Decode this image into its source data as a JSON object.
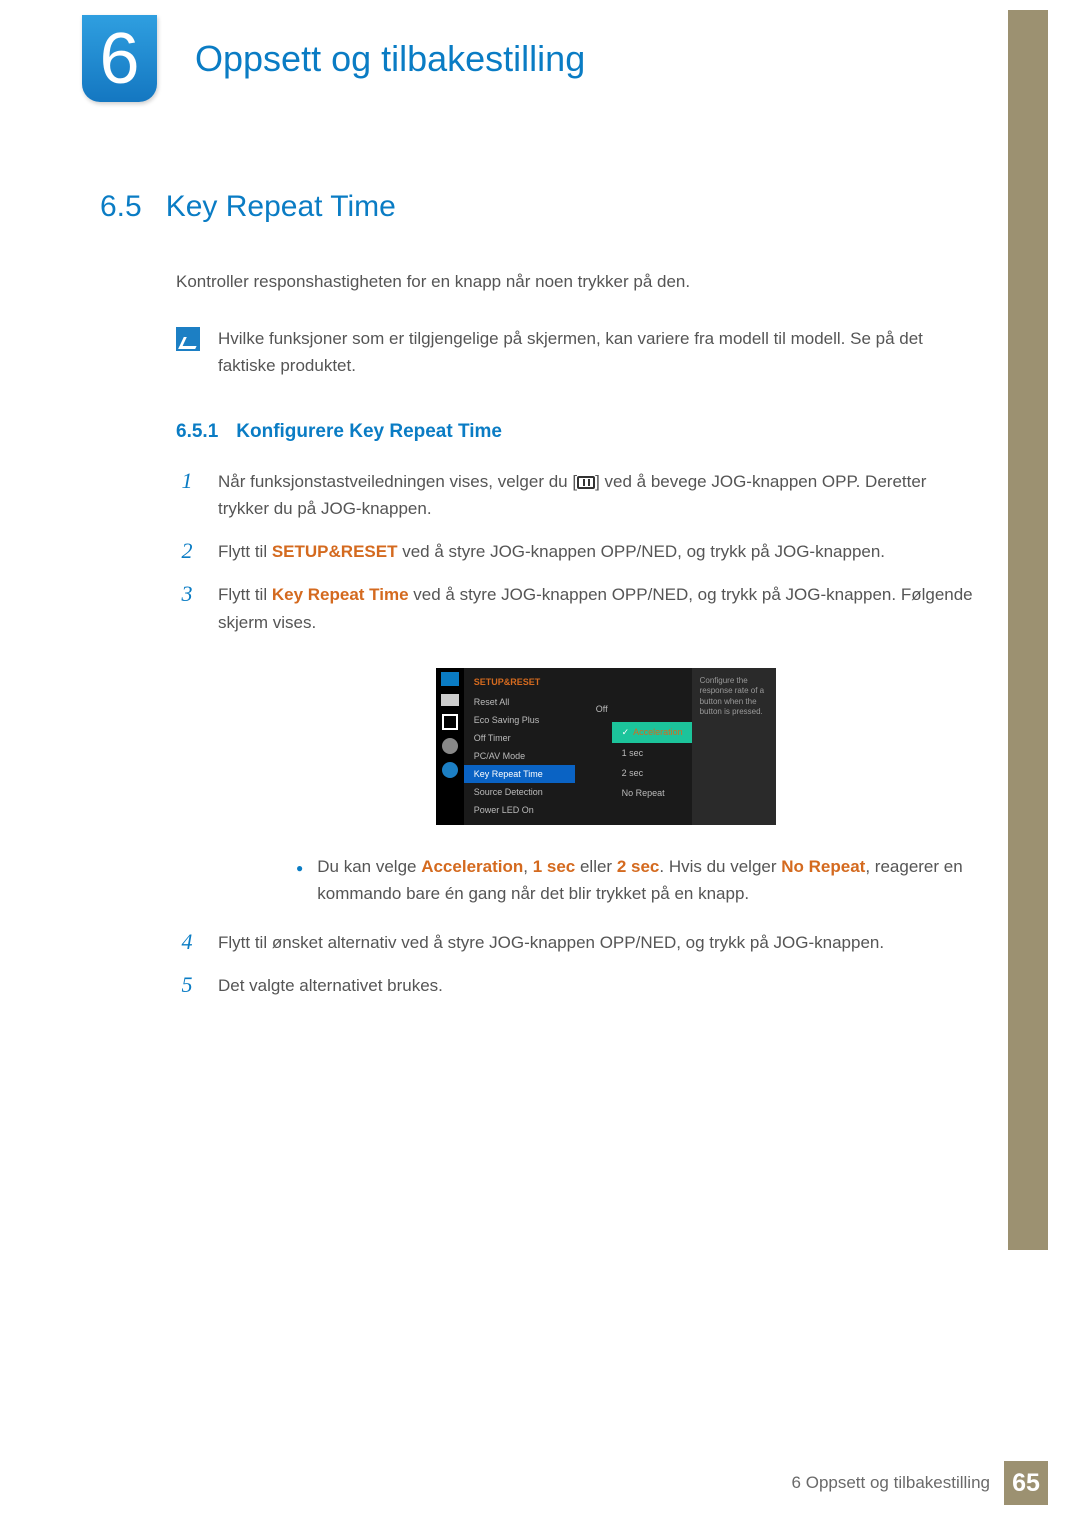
{
  "chapter": {
    "number": "6",
    "title": "Oppsett og tilbakestilling"
  },
  "section": {
    "number": "6.5",
    "title": "Key Repeat Time"
  },
  "intro": "Kontroller responshastigheten for en knapp når noen trykker på den.",
  "note": "Hvilke funksjoner som er tilgjengelige på skjermen, kan variere fra modell til modell. Se på det faktiske produktet.",
  "subsection": {
    "number": "6.5.1",
    "title": "Konfigurere Key Repeat Time"
  },
  "steps": {
    "s1a": "Når funksjonstastveiledningen vises, velger du [",
    "s1b": "] ved å bevege JOG-knappen OPP. Deretter trykker du på JOG-knappen.",
    "s2a": "Flytt til ",
    "s2_kw": "SETUP&RESET",
    "s2b": " ved å styre JOG-knappen OPP/NED, og trykk på JOG-knappen.",
    "s3a": "Flytt til ",
    "s3_kw": "Key Repeat Time",
    "s3b": " ved å styre JOG-knappen OPP/NED, og trykk på JOG-knappen. Følgende skjerm vises.",
    "bullet_a": "Du kan velge ",
    "b_kw1": "Acceleration",
    "b_sep1": ", ",
    "b_kw2": "1 sec",
    "b_sep2": " eller ",
    "b_kw3": "2 sec",
    "b_sep3": ". Hvis du velger ",
    "b_kw4": "No Repeat",
    "b_end": ", reagerer en kommando bare én gang når det blir trykket på en knapp.",
    "s4": "Flytt til ønsket alternativ ved å styre JOG-knappen OPP/NED, og trykk på JOG-knappen.",
    "s5": "Det valgte alternativet brukes."
  },
  "step_nums": {
    "n1": "1",
    "n2": "2",
    "n3": "3",
    "n4": "4",
    "n5": "5"
  },
  "osd": {
    "header": "SETUP&RESET",
    "items": [
      "Reset All",
      "Eco Saving Plus",
      "Off Timer",
      "PC/AV Mode",
      "Key Repeat Time",
      "Source Detection",
      "Power LED On"
    ],
    "value_off": "Off",
    "sub": [
      "Acceleration",
      "1 sec",
      "2 sec",
      "No Repeat"
    ],
    "help": "Configure the response rate of a button when the button is pressed."
  },
  "footer": {
    "text": "6 Oppsett og tilbakestilling",
    "page": "65"
  }
}
